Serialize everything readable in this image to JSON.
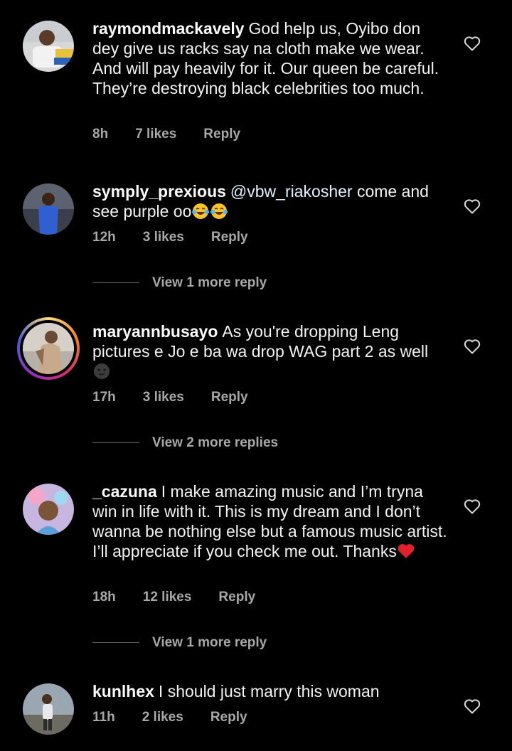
{
  "comments": [
    {
      "username": "raymondmackavely",
      "text": "God help us, Oyibo don dey give us racks say na cloth make we wear. And will pay heavily for it. Our queen be careful. They’re destroying black celebrities too much.",
      "time": "8h",
      "likes": "7 likes",
      "reply": "Reply"
    },
    {
      "username": "symply_prexious",
      "mention": "@vbw_riakosher",
      "text": "come and see purple oo",
      "time": "12h",
      "likes": "3 likes",
      "reply": "Reply",
      "view_replies": "View 1 more reply"
    },
    {
      "username": "maryannbusayo",
      "text": "As you're dropping Leng pictures e Jo e ba wa drop WAG part 2 as well",
      "time": "17h",
      "likes": "3 likes",
      "reply": "Reply",
      "view_replies": "View 2 more replies"
    },
    {
      "username": "_cazuna",
      "text": "I make amazing music and I’m tryna win in life with it. This is my dream and I don’t wanna be nothing else but a famous music artist. I’ll appreciate if you check me out. Thanks",
      "time": "18h",
      "likes": "12 likes",
      "reply": "Reply",
      "view_replies": "View 1 more reply"
    },
    {
      "username": "kunlhex",
      "text": "I should just marry this woman",
      "time": "11h",
      "likes": "2 likes",
      "reply": "Reply"
    }
  ],
  "icons": {
    "like": "heart-outline-icon",
    "laugh": "tears-of-joy-emoji",
    "smirk": "new-moon-face-emoji",
    "heart": "red-heart-emoji"
  },
  "colors": {
    "background": "#000000",
    "text": "#f3f3f3",
    "muted": "#a8a8a8",
    "story_ring": "#d62976"
  }
}
